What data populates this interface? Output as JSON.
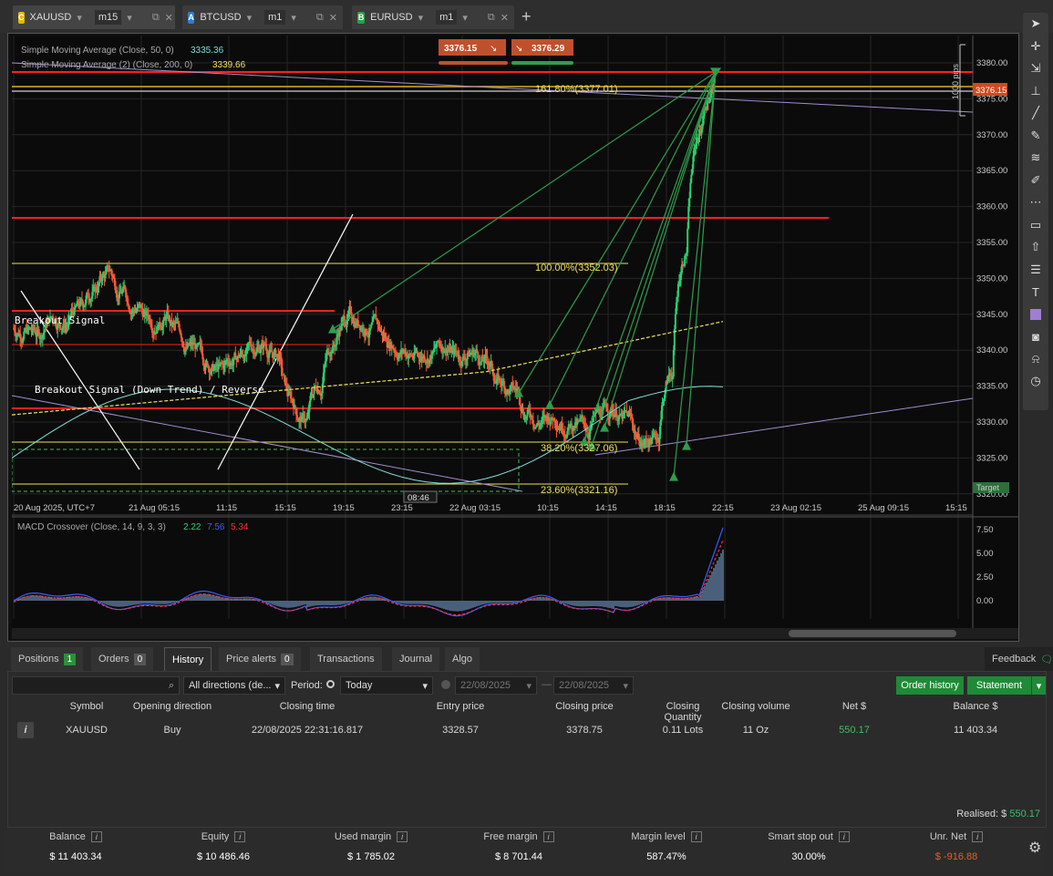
{
  "tabs": [
    {
      "badge": "C",
      "badge_color": "#e6b800",
      "symbol": "XAUUSD",
      "timeframe": "m15",
      "active": true
    },
    {
      "badge": "A",
      "badge_color": "#2a7fd4",
      "symbol": "BTCUSD",
      "timeframe": "m1",
      "active": false
    },
    {
      "badge": "B",
      "badge_color": "#2e9e45",
      "symbol": "EURUSD",
      "timeframe": "m1",
      "active": false
    }
  ],
  "add_tab": "+",
  "chart": {
    "sma1_label": "Simple Moving Average (Close, 50, 0)",
    "sma1_value": "3335.36",
    "sma2_label": "Simple Moving Average (2) (Close, 200, 0)",
    "sma2_value": "3339.66",
    "sell_price": "3376.15",
    "buy_price": "3376.29",
    "current_price": "3376.15",
    "pips_label": "1000 pips",
    "fib_161": "161.80%(3377.01)",
    "fib_100": "100.00%(3352.03)",
    "fib_38": "38.20%(3327.06)",
    "fib_23": "23.60%(3321.16)",
    "breakout1": "Breakout Signal",
    "breakout2": "Breakout Signal (Down Trend) / Reverse",
    "price_ticks": [
      "3380.00",
      "3375.00",
      "3370.00",
      "3365.00",
      "3360.00",
      "3355.00",
      "3350.00",
      "3345.00",
      "3340.00",
      "3335.00",
      "3330.00",
      "3325.00",
      "3320.00"
    ],
    "time_ticks": [
      "20 Aug 2025, UTC+7",
      "21 Aug 05:15",
      "11:15",
      "15:15",
      "19:15",
      "23:15",
      "22 Aug 03:15",
      "10:15",
      "14:15",
      "18:15",
      "22:15",
      "23 Aug 02:15",
      "25 Aug 09:15",
      "15:15"
    ],
    "countdown": "08:46",
    "target_label": "Target",
    "macd_label": "MACD Crossover (Close, 14, 9, 3, 3)",
    "macd_v1": "2.22",
    "macd_v2": "7.56",
    "macd_v3": "5.34",
    "macd_ticks": [
      "7.50",
      "5.00",
      "2.50",
      "0.00"
    ]
  },
  "bottom_tabs": [
    {
      "label": "Positions",
      "badge": "1"
    },
    {
      "label": "Orders",
      "badge": "0"
    },
    {
      "label": "History",
      "badge": ""
    },
    {
      "label": "Price alerts",
      "badge": "0"
    },
    {
      "label": "Transactions",
      "badge": ""
    },
    {
      "label": "Journal",
      "badge": ""
    },
    {
      "label": "Algo",
      "badge": ""
    }
  ],
  "feedback": "Feedback",
  "filters": {
    "direction": "All directions (de...",
    "period_label": "Period:",
    "period_value": "Today",
    "date_from": "22/08/2025",
    "date_to": "22/08/2025",
    "order_history": "Order history",
    "statement": "Statement"
  },
  "columns": [
    "Symbol",
    "Opening direction",
    "Closing time",
    "Entry price",
    "Closing price",
    "Closing Quantity",
    "Closing volume",
    "Net $",
    "Balance $"
  ],
  "rows": [
    {
      "symbol": "XAUUSD",
      "direction": "Buy",
      "closing_time": "22/08/2025 22:31:16.817",
      "entry": "3328.57",
      "closing": "3378.75",
      "qty": "0.11 Lots",
      "volume": "11 Oz",
      "net": "550.17",
      "balance": "11 403.34"
    }
  ],
  "realised_label": "Realised:",
  "realised_currency": "$",
  "realised_value": "550.17",
  "summary": [
    {
      "label": "Balance",
      "value": "$ 11 403.34"
    },
    {
      "label": "Equity",
      "value": "$ 10 486.46"
    },
    {
      "label": "Used margin",
      "value": "$ 1 785.02"
    },
    {
      "label": "Free margin",
      "value": "$ 8 701.44"
    },
    {
      "label": "Margin level",
      "value": "587.47%"
    },
    {
      "label": "Smart stop out",
      "value": "30.00%"
    },
    {
      "label": "Unr. Net",
      "value": "$ -916.88"
    }
  ]
}
